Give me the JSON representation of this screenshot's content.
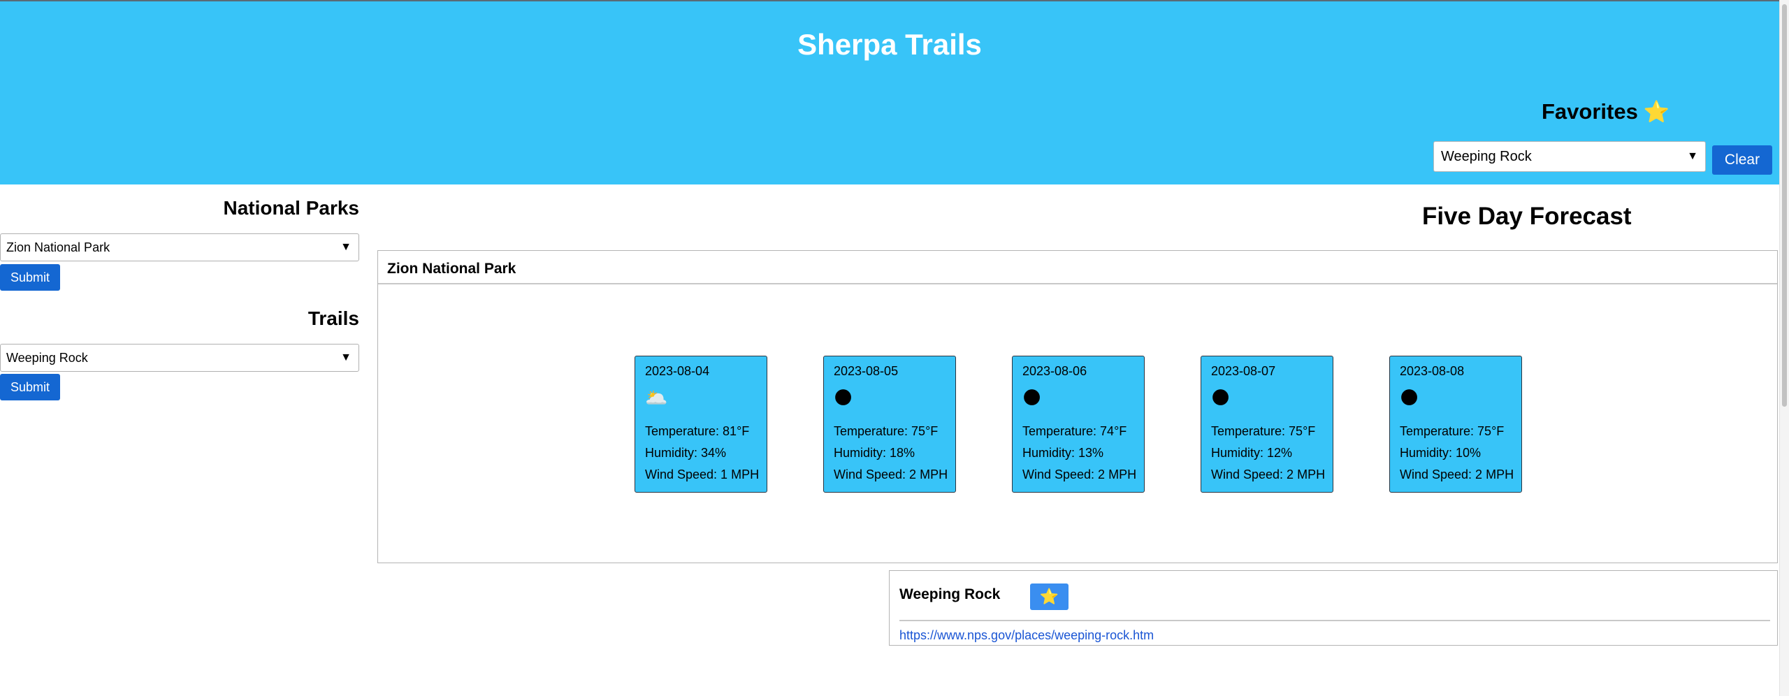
{
  "header": {
    "title": "Sherpa Trails",
    "favorites_heading": "Favorites",
    "favorites_icon": "star-icon",
    "favorites_selected": "Weeping Rock",
    "clear_label": "Clear",
    "background_color": "#38c4f8"
  },
  "sidebar": {
    "parks_heading": "National Parks",
    "parks_selected": "Zion National Park",
    "parks_submit": "Submit",
    "trails_heading": "Trails",
    "trails_selected": "Weeping Rock",
    "trails_submit": "Submit"
  },
  "forecast": {
    "heading": "Five Day Forecast",
    "park_name": "Zion National Park",
    "days": [
      {
        "date": "2023-08-04",
        "icon": "partly-cloudy-night-icon",
        "glyph": "🌥️",
        "temperature": "Temperature: 81°F",
        "humidity": "Humidity: 34%",
        "wind": "Wind Speed: 1 MPH"
      },
      {
        "date": "2023-08-05",
        "icon": "clear-night-icon",
        "glyph": "🌑",
        "temperature": "Temperature: 75°F",
        "humidity": "Humidity: 18%",
        "wind": "Wind Speed: 2 MPH"
      },
      {
        "date": "2023-08-06",
        "icon": "clear-night-icon",
        "glyph": "🌑",
        "temperature": "Temperature: 74°F",
        "humidity": "Humidity: 13%",
        "wind": "Wind Speed: 2 MPH"
      },
      {
        "date": "2023-08-07",
        "icon": "clear-night-icon",
        "glyph": "🌑",
        "temperature": "Temperature: 75°F",
        "humidity": "Humidity: 12%",
        "wind": "Wind Speed: 2 MPH"
      },
      {
        "date": "2023-08-08",
        "icon": "clear-night-icon",
        "glyph": "🌑",
        "temperature": "Temperature: 75°F",
        "humidity": "Humidity: 10%",
        "wind": "Wind Speed: 2 MPH"
      }
    ]
  },
  "trail": {
    "name": "Weeping Rock",
    "favorite_icon": "star-icon",
    "link": "https://www.nps.gov/places/weeping-rock.htm"
  }
}
